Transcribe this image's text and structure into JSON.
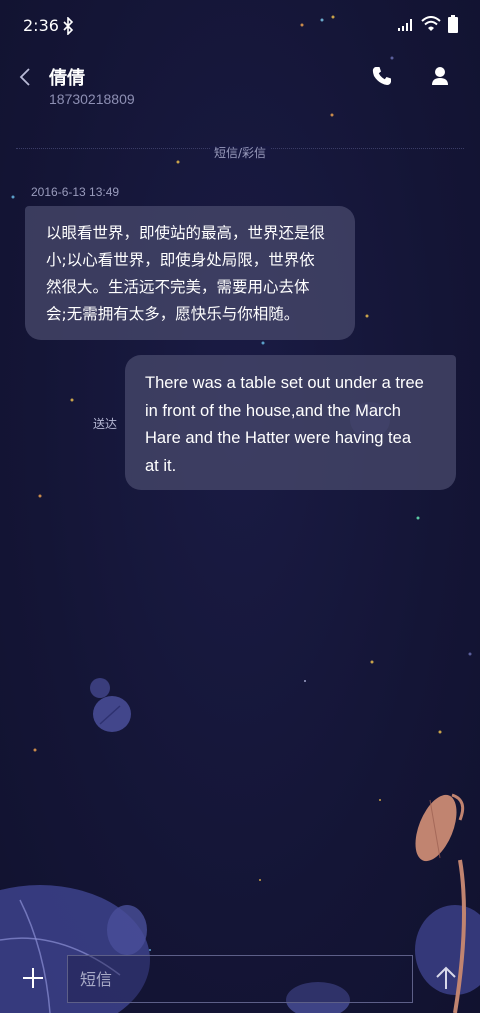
{
  "status_bar": {
    "time": "2:36",
    "icons": [
      "bluetooth-icon",
      "signal-icon",
      "wifi-icon",
      "battery-icon"
    ]
  },
  "header": {
    "contact_name": "倩倩",
    "phone_number": "18730218809",
    "icons": [
      "back-icon",
      "call-icon",
      "contact-person-icon"
    ]
  },
  "conversation": {
    "channel_label": "短信/彩信",
    "messages": [
      {
        "direction": "incoming",
        "timestamp": "2016-6-13 13:49",
        "lines": [
          "以眼看世界，即使站的最高，世界还是很",
          "小;以心看世界，即使身处局限，世界依",
          "然很大。生活远不完美，需要用心去体",
          "会;无需拥有太多，愿快乐与你相随。"
        ]
      },
      {
        "direction": "outgoing",
        "status": "送达",
        "lines": [
          "There was a table set out under a tree",
          "in front of the house,and the March",
          "Hare and the Hatter were having tea",
          "at it."
        ]
      }
    ]
  },
  "composer": {
    "placeholder": "短信",
    "icons": [
      "add-icon",
      "send-icon"
    ]
  },
  "colors": {
    "background": "#151638",
    "bubble": "#48496c",
    "secondary_text": "#8d8fb3"
  }
}
